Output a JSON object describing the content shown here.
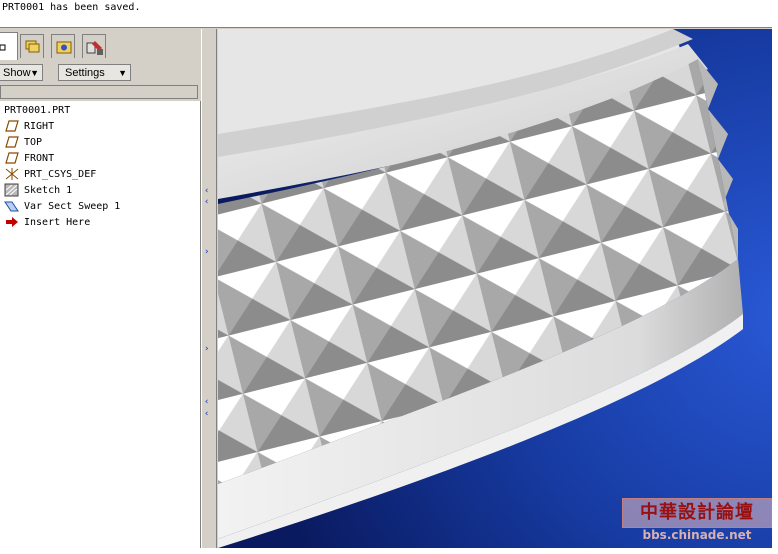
{
  "status": {
    "message": "PRT0001 has been saved."
  },
  "navigator": {
    "tabs": [
      {
        "icon": "model-tree-icon"
      },
      {
        "icon": "folder-layers-icon"
      },
      {
        "icon": "favorites-folder-icon"
      },
      {
        "icon": "connections-icon"
      }
    ],
    "show_label": "Show",
    "settings_label": "Settings"
  },
  "tree": {
    "root": "PRT0001.PRT",
    "items": [
      {
        "label": "RIGHT",
        "icon": "datum-plane-icon"
      },
      {
        "label": "TOP",
        "icon": "datum-plane-icon"
      },
      {
        "label": "FRONT",
        "icon": "datum-plane-icon"
      },
      {
        "label": "PRT_CSYS_DEF",
        "icon": "coordinate-system-icon"
      },
      {
        "label": "Sketch 1",
        "icon": "sketch-icon"
      },
      {
        "label": "Var Sect Sweep 1",
        "icon": "sweep-icon"
      },
      {
        "label": "Insert Here",
        "icon": "insert-arrow-icon"
      }
    ]
  },
  "watermark": {
    "title": "中華設計論壇",
    "url": "bbs.chinade.net"
  },
  "colors": {
    "background_blue": "#1a3aa0",
    "insert_arrow": "#c00000",
    "watermark_red": "#9a1010"
  }
}
